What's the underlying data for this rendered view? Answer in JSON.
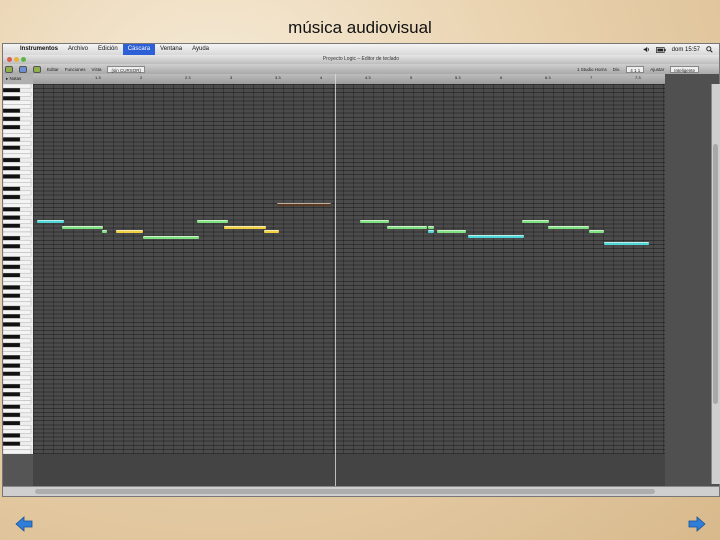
{
  "slide": {
    "title": "música audiovisual"
  },
  "menubar": {
    "apple_glyph": "",
    "app_menu": "Instrumentos",
    "menus": [
      "Archivo",
      "Edición",
      "Cáscara",
      "Ventana",
      "Ayuda"
    ],
    "active_menu": "Cáscara",
    "clock": "dom 15:57",
    "icons": [
      "speaker-icon",
      "battery-icon",
      "spotlight-icon"
    ]
  },
  "window": {
    "title": "Proyecto Logic – Editor de teclado"
  },
  "toolbar": {
    "edit_label": "Editar",
    "functions_label": "Funciones",
    "view_label": "Vista",
    "no_overlap": "(sin CURSOR)",
    "snap_label": "Div.",
    "position": "4 1 1",
    "quantize_label": "Ajustar",
    "quantize_value": "Inteligente",
    "track_name": "1 Studio Horns"
  },
  "track_label": "▸ Notas",
  "ruler": {
    "marks": [
      "1.3",
      "2",
      "2.3",
      "3",
      "3.3",
      "4",
      "4.3",
      "5",
      "5.3",
      "6",
      "6.3",
      "7",
      "7.3",
      "8"
    ]
  },
  "notes": [
    {
      "start": 0.4,
      "length": 3.0,
      "row": 33,
      "color": "#4fd6d6"
    },
    {
      "start": 3.2,
      "length": 4.6,
      "row": 34.5,
      "color": "#7ee07e"
    },
    {
      "start": 7.6,
      "length": 0.6,
      "row": 35.5,
      "color": "#7ee07e"
    },
    {
      "start": 9.2,
      "length": 3.0,
      "row": 35.5,
      "color": "#f0d040"
    },
    {
      "start": 12.2,
      "length": 6.2,
      "row": 37,
      "color": "#7ee07e"
    },
    {
      "start": 18.2,
      "length": 3.4,
      "row": 33.2,
      "color": "#7ee07e"
    },
    {
      "start": 21.2,
      "length": 4.6,
      "row": 34.5,
      "color": "#f0d040"
    },
    {
      "start": 25.6,
      "length": 1.6,
      "row": 35.5,
      "color": "#f0d040"
    },
    {
      "start": 27.0,
      "length": 6.0,
      "row": 29,
      "color": "#5a3a22"
    },
    {
      "start": 36.2,
      "length": 3.2,
      "row": 33.2,
      "color": "#7ee07e"
    },
    {
      "start": 39.2,
      "length": 4.4,
      "row": 34.5,
      "color": "#7ee07e"
    },
    {
      "start": 43.8,
      "length": 0.6,
      "row": 34.5,
      "color": "#7ee07e"
    },
    {
      "start": 43.8,
      "length": 0.6,
      "row": 35.5,
      "color": "#4fd6d6"
    },
    {
      "start": 44.8,
      "length": 3.2,
      "row": 35.5,
      "color": "#7ee07e"
    },
    {
      "start": 48.2,
      "length": 6.2,
      "row": 36.8,
      "color": "#4fd6d6"
    },
    {
      "start": 54.2,
      "length": 3.0,
      "row": 33.2,
      "color": "#7ee07e"
    },
    {
      "start": 57.0,
      "length": 4.6,
      "row": 34.5,
      "color": "#7ee07e"
    },
    {
      "start": 61.6,
      "length": 1.6,
      "row": 35.5,
      "color": "#7ee07e"
    },
    {
      "start": 63.2,
      "length": 5.0,
      "row": 38.5,
      "color": "#4fd6d6"
    }
  ],
  "navigation": {
    "prev_icon": "left-arrow-icon",
    "next_icon": "right-arrow-icon",
    "arrow_color": "#2f7ed8"
  }
}
